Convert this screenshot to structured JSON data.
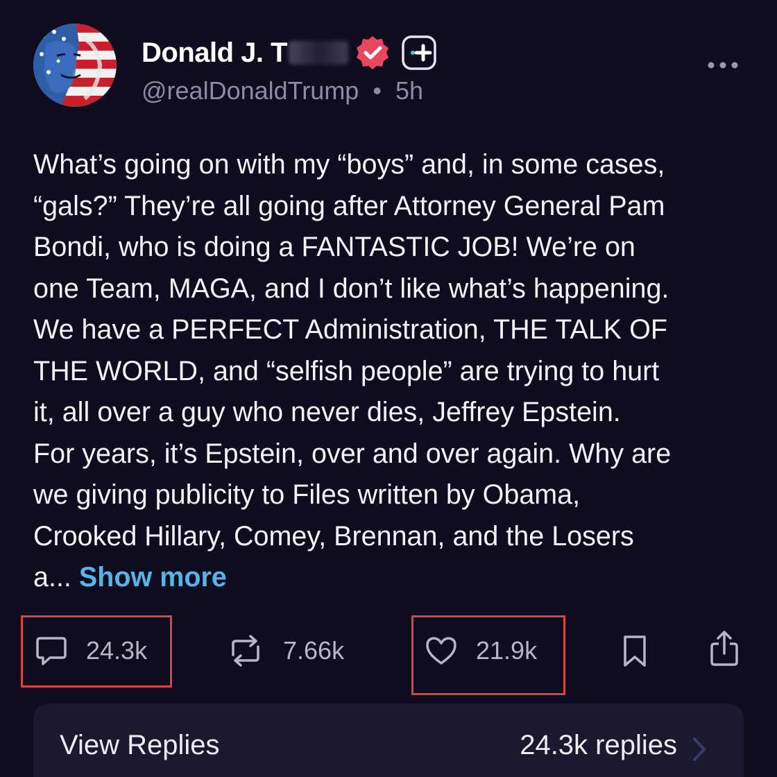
{
  "author": {
    "display_name_visible": "Donald J. T",
    "handle": "@realDonaldTrump",
    "separator": "•",
    "timestamp": "5h",
    "verified_badge_color": "#e8475f",
    "avatar_icon": "flag-face-avatar"
  },
  "post": {
    "lines": [
      "What’s going on with my “boys” and, in some cases,",
      "“gals?” They’re all going after Attorney General Pam",
      "Bondi, who is doing a FANTASTIC JOB! We’re on",
      "one Team, MAGA, and I don’t like what’s happening.",
      "We have a PERFECT Administration, THE TALK OF",
      "THE WORLD, and “selfish people” are trying to hurt",
      "it, all over a guy who never dies, Jeffrey Epstein.",
      "For years, it’s Epstein, over and over again. Why are",
      "we giving publicity to Files written by Obama,",
      "Crooked Hillary, Comey, Brennan, and the Losers"
    ],
    "truncated_prefix": "a...",
    "show_more_label": "Show more"
  },
  "actions": {
    "replies_count": "24.3k",
    "reposts_count": "7.66k",
    "likes_count": "21.9k",
    "reply_icon": "speech-bubble-icon",
    "repost_icon": "repost-arrows-icon",
    "like_icon": "heart-icon",
    "bookmark_icon": "bookmark-icon",
    "share_icon": "share-icon",
    "highlight_color": "#d9453c"
  },
  "replies_bar": {
    "label": "View Replies",
    "count_text": "24.3k replies"
  },
  "colors": {
    "background": "#0e0c1e",
    "link": "#56b4e6",
    "muted": "#8e8aa6"
  }
}
